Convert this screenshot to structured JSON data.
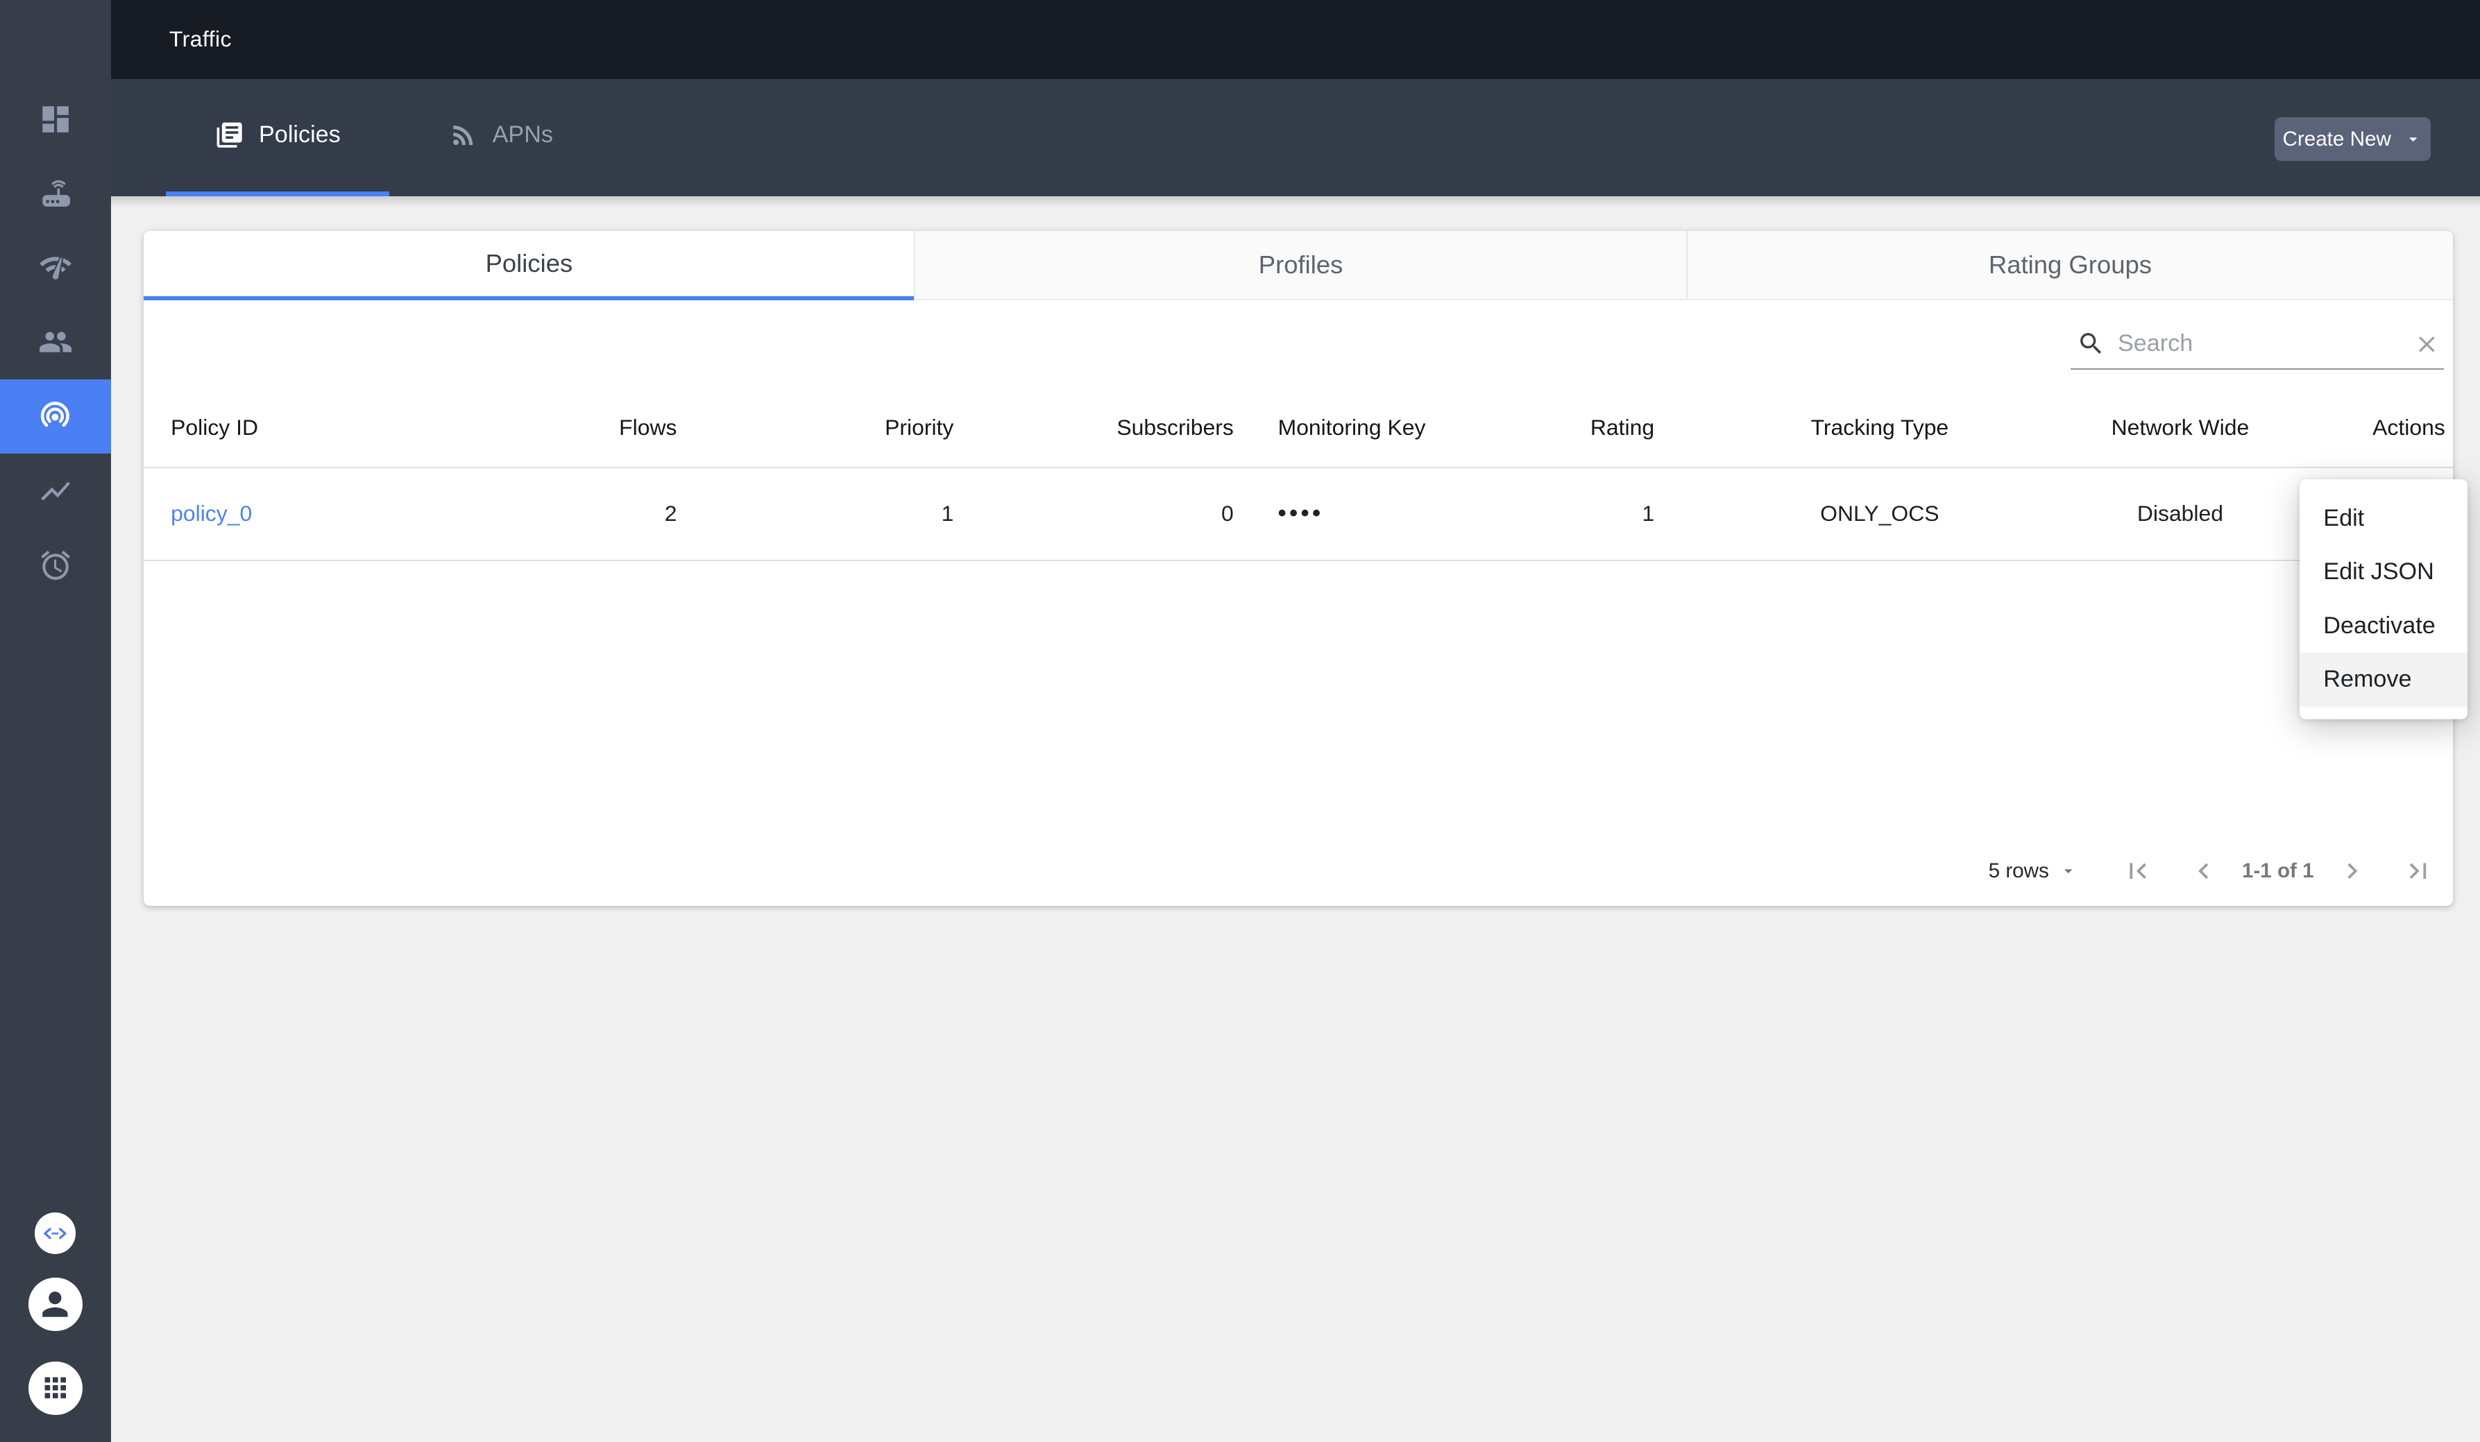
{
  "header": {
    "title": "Traffic"
  },
  "top_tabs": {
    "items": [
      {
        "label": "Policies",
        "icon": "library-books",
        "active": true
      },
      {
        "label": "APNs",
        "icon": "rss",
        "active": false
      }
    ],
    "create_label": "Create New"
  },
  "card_tabs": [
    {
      "label": "Policies",
      "active": true
    },
    {
      "label": "Profiles",
      "active": false
    },
    {
      "label": "Rating Groups",
      "active": false
    }
  ],
  "search": {
    "placeholder": "Search"
  },
  "table": {
    "columns": [
      "Policy ID",
      "Flows",
      "Priority",
      "Subscribers",
      "Monitoring Key",
      "Rating",
      "Tracking Type",
      "Network Wide",
      "Actions"
    ],
    "rows": [
      [
        "policy_0",
        "2",
        "1",
        "0",
        "••••",
        "1",
        "ONLY_OCS",
        "Disabled"
      ]
    ]
  },
  "menu": {
    "items": [
      {
        "label": "Edit",
        "highlighted": false
      },
      {
        "label": "Edit JSON",
        "highlighted": false
      },
      {
        "label": "Deactivate",
        "highlighted": false
      },
      {
        "label": "Remove",
        "highlighted": true
      }
    ]
  },
  "pagination": {
    "rows_per_page": "5 rows",
    "range": "1-1 of 1"
  },
  "sidebar": {
    "nav_icons": [
      "dashboard",
      "equipment",
      "network-check",
      "subscribers",
      "traffic-policies",
      "metrics",
      "alarms"
    ],
    "active_index": 4,
    "bottom_icons": [
      "api-code",
      "account",
      "apps"
    ]
  },
  "colors": {
    "accent_blue": "#4a80f4",
    "link_blue": "#4f82f0",
    "topbar_bg": "#171c24",
    "tabbar_bg": "#343b49",
    "sidebar_bg": "#373d49",
    "create_button_bg": "#5a6378",
    "menu_highlight": "#f3f3f3"
  }
}
